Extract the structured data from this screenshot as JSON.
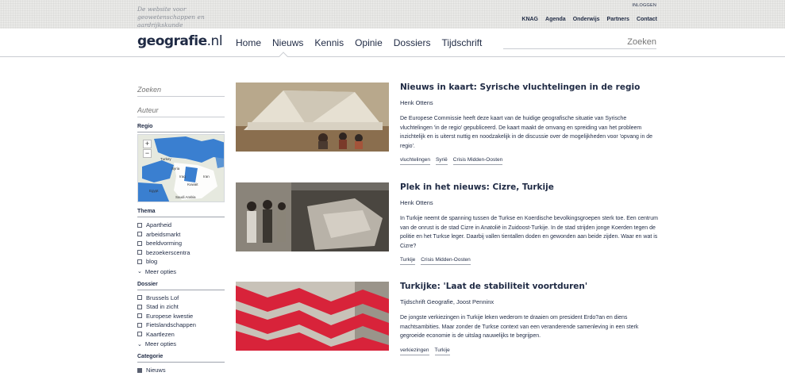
{
  "header": {
    "tagline": "De website voor geowetenschappen en aardrijkskunde",
    "login": "INLOGGEN",
    "top_links": [
      "KNAG",
      "Agenda",
      "Onderwijs",
      "Partners",
      "Contact"
    ]
  },
  "nav": {
    "logo_main": "geografie",
    "logo_suffix": ".nl",
    "items": [
      "Home",
      "Nieuws",
      "Kennis",
      "Opinie",
      "Dossiers",
      "Tijdschrift"
    ],
    "active": "Nieuws",
    "search_placeholder": "Zoeken"
  },
  "sidebar": {
    "search_placeholder": "Zoeken",
    "author_placeholder": "Auteur",
    "regio_label": "Regio",
    "map_labels": [
      "Turkey",
      "Syria",
      "Iraq",
      "Iran",
      "Egypt",
      "Saudi Arabia",
      "Kuwait"
    ],
    "thema_label": "Thema",
    "thema_items": [
      "Apartheid",
      "arbeidsmarkt",
      "beeldvorming",
      "bezoekerscentra",
      "blog"
    ],
    "thema_more": "Meer opties",
    "dossier_label": "Dossier",
    "dossier_items": [
      "Brussels Lof",
      "Stad in zicht",
      "Europese kwestie",
      "Fietslandschappen",
      "Kaartlezen"
    ],
    "dossier_more": "Meer opties",
    "categorie_label": "Categorie",
    "categorie_items": [
      "Nieuws"
    ]
  },
  "articles": [
    {
      "title": "Nieuws in kaart: Syrische vluchtelingen in de regio",
      "author": "Henk Ottens",
      "text": "De Europese Commissie heeft deze kaart van de huidige geografische situatie van Syrische vluchtelingen 'in de regio' gepubliceerd. De kaart maakt de omvang en spreiding van het probleem inzichtelijk en is uiterst nuttig en noodzakelijk in de discussie over de mogelijkheden voor 'opvang in de regio'.",
      "tags": [
        "vluchtelingen",
        "Syrië",
        "Crisis Midden-Oosten"
      ]
    },
    {
      "title": "Plek in het nieuws: Cizre, Turkije",
      "author": "Henk Ottens",
      "text": "In Turkije neemt de spanning tussen de Turkse en Koerdische bevolkingsgroepen sterk toe. Een centrum van de onrust is de stad Cizre in Anatolië in Zuidoost-Turkije. In de stad strijden jonge Koerden tegen de politie en het Turkse leger. Daarbij vallen tientallen doden en gewonden aan beide zijden. Waar en wat is Cizre?",
      "tags": [
        "Turkije",
        "Crisis Midden-Oosten"
      ]
    },
    {
      "title": "Turkijke: 'Laat de stabiliteit voortduren'",
      "author": "Tijdschrift Geografie, Joost Penninx",
      "text": "De jongste verkiezingen in Turkije leken wederom te draaien om president Erdo?an en diens machtsambities. Maar zonder de Turkse context van een veranderende samenleving in een sterk gegroeide economie is de uitslag nauwelijks te begrijpen.",
      "tags": [
        "verkiezingen",
        "Turkije"
      ]
    }
  ]
}
